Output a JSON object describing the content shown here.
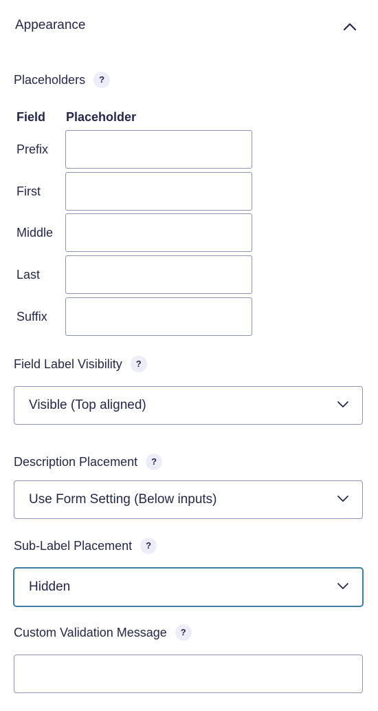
{
  "section": {
    "title": "Appearance",
    "collapse_icon": "chevron-up-icon"
  },
  "placeholders": {
    "label": "Placeholders",
    "help": "?",
    "columns": [
      "Field",
      "Placeholder"
    ],
    "rows": [
      {
        "field": "Prefix",
        "value": ""
      },
      {
        "field": "First",
        "value": ""
      },
      {
        "field": "Middle",
        "value": ""
      },
      {
        "field": "Last",
        "value": ""
      },
      {
        "field": "Suffix",
        "value": ""
      }
    ]
  },
  "field_label_visibility": {
    "label": "Field Label Visibility",
    "help": "?",
    "selected": "Visible (Top aligned)"
  },
  "description_placement": {
    "label": "Description Placement",
    "help": "?",
    "selected": "Use Form Setting (Below inputs)"
  },
  "sublabel_placement": {
    "label": "Sub-Label Placement",
    "help": "?",
    "selected": "Hidden"
  },
  "custom_validation": {
    "label": "Custom Validation Message",
    "help": "?",
    "value": ""
  },
  "colors": {
    "text": "#242748",
    "border": "#9092b2",
    "focus": "#3e7da6",
    "badge_bg": "#ecedf8"
  }
}
